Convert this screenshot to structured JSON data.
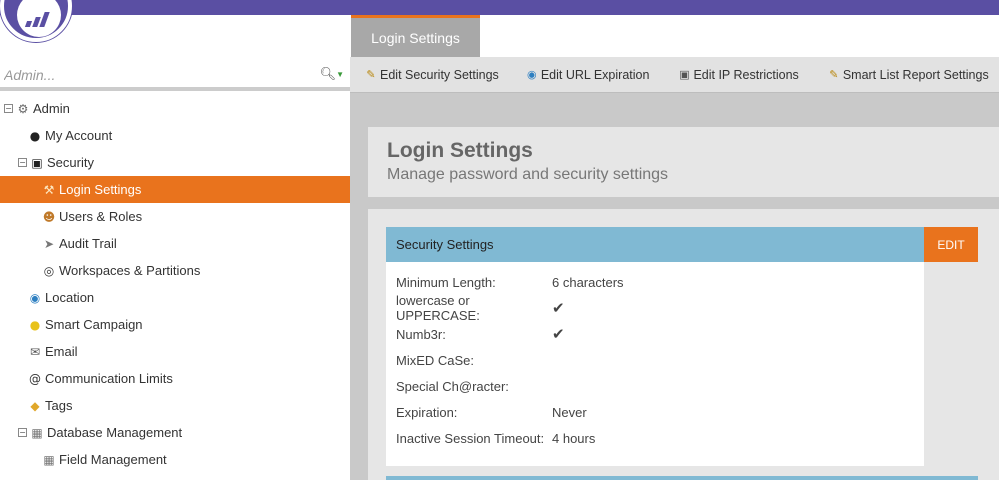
{
  "colors": {
    "brand": "#5a4fa3",
    "accent": "#e9731d",
    "panel_header": "#80b9d3",
    "check": "#4f8a2a"
  },
  "sidebar": {
    "search": {
      "placeholder": "Admin..."
    },
    "tree": [
      {
        "label": "Admin",
        "icon": "gear-icon"
      },
      {
        "label": "My Account",
        "icon": "person-icon"
      },
      {
        "label": "Security",
        "icon": "lock-icon"
      },
      {
        "label": "Login Settings",
        "icon": "login-settings-icon"
      },
      {
        "label": "Users & Roles",
        "icon": "users-icon"
      },
      {
        "label": "Audit Trail",
        "icon": "audit-trail-icon"
      },
      {
        "label": "Workspaces & Partitions",
        "icon": "globe-icon"
      },
      {
        "label": "Location",
        "icon": "earth-icon"
      },
      {
        "label": "Smart Campaign",
        "icon": "lightbulb-icon"
      },
      {
        "label": "Email",
        "icon": "email-icon"
      },
      {
        "label": "Communication Limits",
        "icon": "at-icon"
      },
      {
        "label": "Tags",
        "icon": "tag-icon"
      },
      {
        "label": "Database Management",
        "icon": "database-icon"
      },
      {
        "label": "Field Management",
        "icon": "field-icon"
      }
    ]
  },
  "tabs": {
    "active": "Login Settings"
  },
  "toolbar": {
    "edit_security": "Edit Security Settings",
    "edit_url_expiration": "Edit URL Expiration",
    "edit_ip_restrictions": "Edit IP Restrictions",
    "smart_list_report": "Smart List Report Settings"
  },
  "page": {
    "title": "Login Settings",
    "subtitle": "Manage password and security settings"
  },
  "security_panel": {
    "title": "Security Settings",
    "edit_label": "EDIT",
    "rows": [
      {
        "label": "Minimum Length:",
        "value": "6 characters"
      },
      {
        "label": "lowercase or UPPERCASE:",
        "value": "✔"
      },
      {
        "label": "Numb3r:",
        "value": "✔"
      },
      {
        "label": "MixED CaSe:",
        "value": ""
      },
      {
        "label": "Special Ch@racter:",
        "value": ""
      },
      {
        "label": "Expiration:",
        "value": "Never"
      },
      {
        "label": "Inactive Session Timeout:",
        "value": "4 hours"
      }
    ]
  }
}
